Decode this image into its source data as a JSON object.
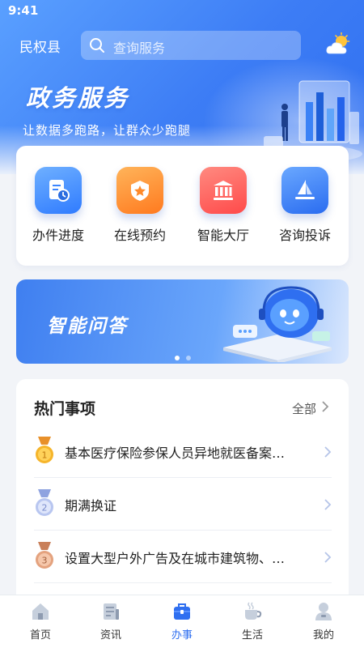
{
  "status": {
    "time": "9:41"
  },
  "header": {
    "city": "民权县",
    "search_placeholder": "查询服务"
  },
  "hero": {
    "title": "政务服务",
    "subtitle": "让数据多跑路，让群众少跑腿"
  },
  "quick_actions": [
    {
      "label": "办件进度",
      "icon": "progress-document-icon",
      "color": "#3c86ff"
    },
    {
      "label": "在线预约",
      "icon": "star-badge-icon",
      "color": "#ff8a2a"
    },
    {
      "label": "智能大厅",
      "icon": "government-hall-icon",
      "color": "#ff5a5a"
    },
    {
      "label": "咨询投诉",
      "icon": "paper-plane-icon",
      "color": "#2f7bff"
    }
  ],
  "banner": {
    "title": "智能问答",
    "slides": 2,
    "active_slide": 1
  },
  "hot": {
    "title": "热门事项",
    "all_label": "全部",
    "items": [
      {
        "rank": "1",
        "text": "基本医疗保险参保人员异地就医备案…"
      },
      {
        "rank": "2",
        "text": "期满换证"
      },
      {
        "rank": "3",
        "text": "设置大型户外广告及在城市建筑物、…"
      }
    ]
  },
  "tabbar": {
    "items": [
      {
        "label": "首页",
        "icon": "home-icon"
      },
      {
        "label": "资讯",
        "icon": "news-icon"
      },
      {
        "label": "办事",
        "icon": "briefcase-icon"
      },
      {
        "label": "生活",
        "icon": "coffee-cup-icon"
      },
      {
        "label": "我的",
        "icon": "user-icon"
      }
    ],
    "active_index": 2
  },
  "colors": {
    "primary": "#2f6ff0",
    "hero_start": "#5aa0ff",
    "hero_end": "#2f6ff0"
  }
}
